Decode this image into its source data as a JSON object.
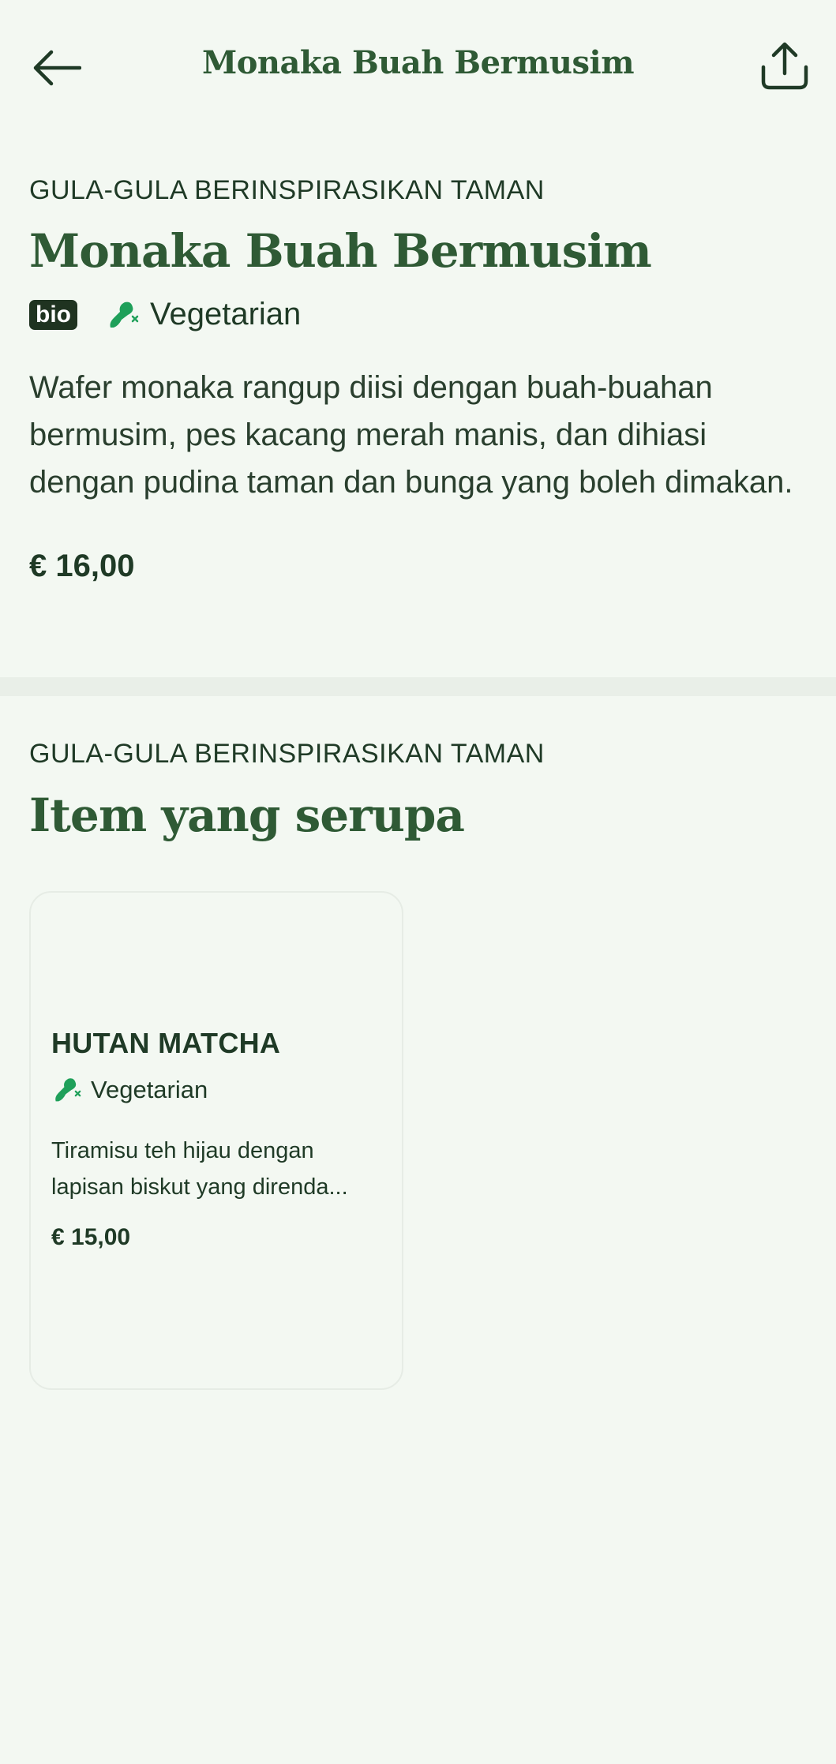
{
  "header": {
    "title": "Monaka Buah Bermusim",
    "back_icon": "arrow-left-icon",
    "share_icon": "share-icon"
  },
  "item": {
    "category": "GULA-GULA BERINSPIRASIKAN TAMAN",
    "name": "Monaka Buah Bermusim",
    "badge": "bio",
    "diet_label": "Vegetarian",
    "description": "Wafer monaka rangup diisi dengan buah-buahan bermusim, pes kacang merah manis, dan dihiasi dengan pudina taman dan bunga yang boleh dimakan.",
    "price": "€ 16,00"
  },
  "similar": {
    "category": "GULA-GULA BERINSPIRASIKAN TAMAN",
    "title": "Item yang serupa",
    "items": [
      {
        "name": "HUTAN MATCHA",
        "diet_label": "Vegetarian",
        "description_line1": "Tiramisu teh hijau dengan",
        "description_line2": "lapisan biskut yang direnda...",
        "price": "€ 15,00"
      }
    ]
  },
  "colors": {
    "background": "#f3f8f2",
    "title_green": "#2f5a35",
    "text_dark": "#1f3a26",
    "veg_icon_green": "#1fa05a",
    "bio_badge_bg": "#1f3320"
  }
}
